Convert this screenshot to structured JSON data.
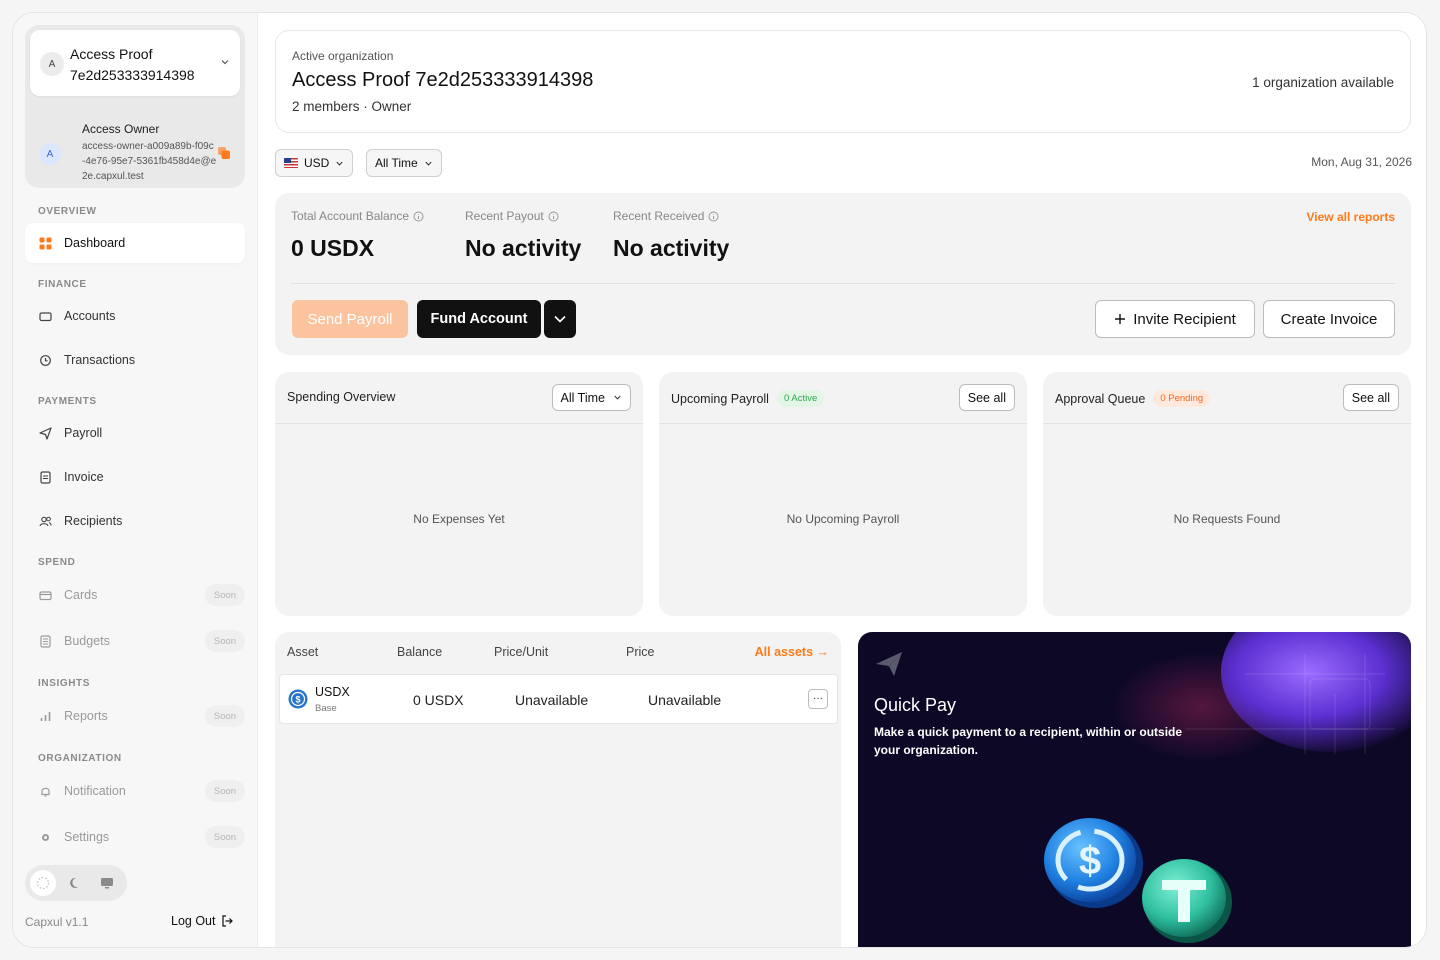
{
  "sidebar": {
    "org": {
      "avatar_letter": "A",
      "name": "Access Proof 7e2d253333914398"
    },
    "user": {
      "avatar_letter": "A",
      "name": "Access Owner",
      "email": "access-owner-a009a89b-f09c-4e76-95e7-5361fb458d4e@e2e.capxul.test"
    },
    "sections": {
      "overview": "OVERVIEW",
      "finance": "FINANCE",
      "payments": "PAYMENTS",
      "spend": "SPEND",
      "insights": "INSIGHTS",
      "organization": "ORGANIZATION"
    },
    "items": {
      "dashboard": "Dashboard",
      "accounts": "Accounts",
      "transactions": "Transactions",
      "payroll": "Payroll",
      "invoice": "Invoice",
      "recipients": "Recipients",
      "cards": "Cards",
      "budgets": "Budgets",
      "reports": "Reports",
      "notification": "Notification",
      "settings": "Settings"
    },
    "soon_label": "Soon",
    "version": "Capxul v1.1",
    "logout": "Log Out",
    "accent": "#ff7a1a"
  },
  "header": {
    "label": "Active organization",
    "title": "Access Proof 7e2d253333914398",
    "meta": "2 members · Owner",
    "available": "1 organization available"
  },
  "filters": {
    "currency": "USD",
    "period": "All Time",
    "date": "Mon, Aug 31, 2026"
  },
  "balance": {
    "total_label": "Total Account Balance",
    "total_value": "0 USDX",
    "payout_label": "Recent Payout",
    "payout_value": "No activity",
    "received_label": "Recent Received",
    "received_value": "No activity",
    "reports_link": "View all reports",
    "send_payroll": "Send Payroll",
    "fund_account": "Fund Account",
    "invite_recipient": "Invite Recipient",
    "create_invoice": "Create Invoice"
  },
  "panels": {
    "spending": {
      "title": "Spending Overview",
      "filter": "All Time",
      "empty": "No Expenses Yet"
    },
    "payroll": {
      "title": "Upcoming Payroll",
      "badge": "0 Active",
      "button": "See all",
      "empty": "No Upcoming Payroll"
    },
    "approval": {
      "title": "Approval Queue",
      "badge": "0 Pending",
      "button": "See all",
      "empty": "No Requests Found"
    }
  },
  "assets": {
    "headers": {
      "asset": "Asset",
      "balance": "Balance",
      "price_unit": "Price/Unit",
      "price": "Price"
    },
    "all_link": "All assets →",
    "rows": [
      {
        "symbol": "USDX",
        "network": "Base",
        "balance": "0 USDX",
        "price_unit": "Unavailable",
        "price": "Unavailable",
        "more": "···"
      }
    ]
  },
  "quickpay": {
    "title": "Quick Pay",
    "description": "Make a quick payment to a recipient, within or outside your organization."
  }
}
